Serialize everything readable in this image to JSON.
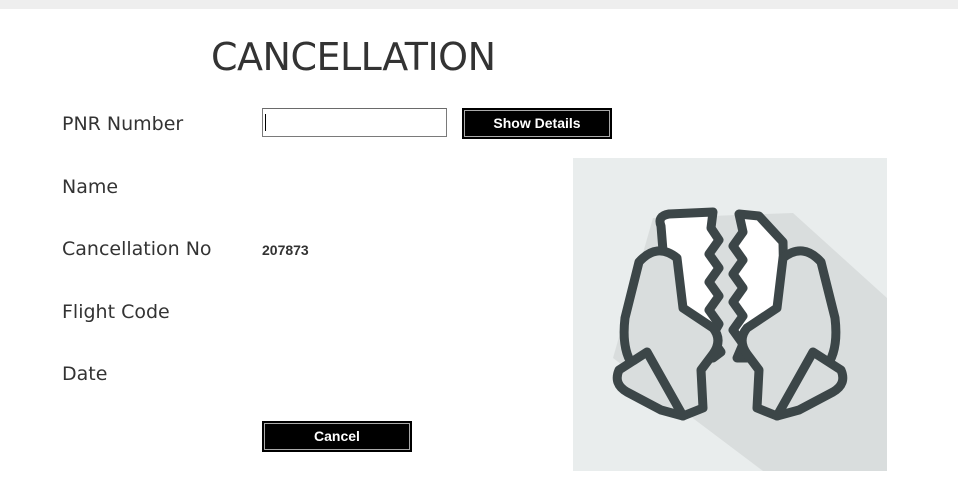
{
  "page": {
    "title": "CANCELLATION"
  },
  "form": {
    "labels": {
      "pnr": "PNR Number",
      "name": "Name",
      "cancellation_no": "Cancellation No",
      "flight_code": "Flight Code",
      "date": "Date"
    },
    "pnr_value": "",
    "cancellation_no_value": "207873",
    "show_details_label": "Show Details",
    "cancel_label": "Cancel"
  },
  "illustration": {
    "icon": "torn-ticket-hands-icon",
    "background_color": "#e9eded",
    "icon_color": "#3c4648"
  },
  "colors": {
    "button_bg": "#000000",
    "button_text": "#ffffff",
    "text": "#333333"
  }
}
